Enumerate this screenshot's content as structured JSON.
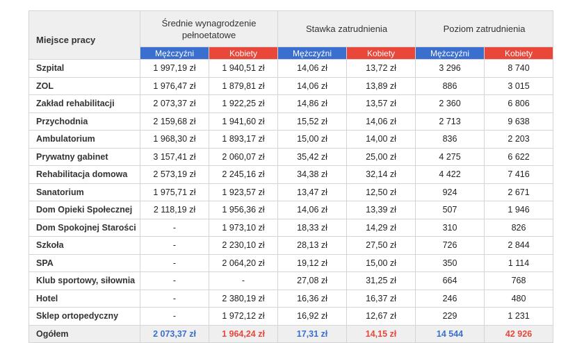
{
  "header": {
    "place_label": "Miejsce pracy",
    "group1": "Średnie wynagrodzenie pełnoetatowe",
    "group2": "Stawka zatrudnienia",
    "group3": "Poziom zatrudnienia",
    "male": "Mężczyźni",
    "female": "Kobiety"
  },
  "colors": {
    "male": "#3a6fcf",
    "female": "#e8473a",
    "header_bg": "#efefef"
  },
  "rows": [
    {
      "place": "Szpital",
      "wm": "1 997,19 zł",
      "wf": "1 940,51 zł",
      "rm": "14,06 zł",
      "rf": "13,72 zł",
      "em": "3 296",
      "ef": "8 740"
    },
    {
      "place": "ZOL",
      "wm": "1 976,47 zł",
      "wf": "1 879,81 zł",
      "rm": "14,06 zł",
      "rf": "13,89 zł",
      "em": "886",
      "ef": "3 015"
    },
    {
      "place": "Zakład rehabilitacji",
      "wm": "2 073,37 zł",
      "wf": "1 922,25 zł",
      "rm": "14,86 zł",
      "rf": "13,57 zł",
      "em": "2 360",
      "ef": "6 806"
    },
    {
      "place": "Przychodnia",
      "wm": "2 159,68 zł",
      "wf": "1 941,60 zł",
      "rm": "15,52 zł",
      "rf": "14,06 zł",
      "em": "2 713",
      "ef": "9 638"
    },
    {
      "place": "Ambulatorium",
      "wm": "1 968,30 zł",
      "wf": "1 893,17 zł",
      "rm": "15,00 zł",
      "rf": "14,00 zł",
      "em": "836",
      "ef": "2 203"
    },
    {
      "place": "Prywatny gabinet",
      "wm": "3 157,41 zł",
      "wf": "2 060,07 zł",
      "rm": "35,42 zł",
      "rf": "25,00 zł",
      "em": "4 275",
      "ef": "6 622"
    },
    {
      "place": "Rehabilitacja domowa",
      "wm": "2 573,19 zł",
      "wf": "2 245,16 zł",
      "rm": "34,38 zł",
      "rf": "32,14 zł",
      "em": "4 422",
      "ef": "7 416"
    },
    {
      "place": "Sanatorium",
      "wm": "1 975,71 zł",
      "wf": "1 923,57 zł",
      "rm": "13,47 zł",
      "rf": "12,50 zł",
      "em": "924",
      "ef": "2 671"
    },
    {
      "place": "Dom Opieki Społecznej",
      "wm": "2 118,19 zł",
      "wf": "1 956,36 zł",
      "rm": "14,06 zł",
      "rf": "13,39 zł",
      "em": "507",
      "ef": "1 946"
    },
    {
      "place": "Dom Spokojnej Starości",
      "wm": "-",
      "wf": "1 973,10 zł",
      "rm": "18,33 zł",
      "rf": "14,29 zł",
      "em": "310",
      "ef": "826"
    },
    {
      "place": "Szkoła",
      "wm": "-",
      "wf": "2 230,10 zł",
      "rm": "28,13 zł",
      "rf": "27,50 zł",
      "em": "726",
      "ef": "2 844"
    },
    {
      "place": "SPA",
      "wm": "-",
      "wf": "2 064,20 zł",
      "rm": "19,12 zł",
      "rf": "15,00 zł",
      "em": "350",
      "ef": "1 114"
    },
    {
      "place": "Klub sportowy, siłownia",
      "wm": "-",
      "wf": "-",
      "rm": "27,08 zł",
      "rf": "31,25 zł",
      "em": "664",
      "ef": "768"
    },
    {
      "place": "Hotel",
      "wm": "-",
      "wf": "2 380,19 zł",
      "rm": "16,36 zł",
      "rf": "16,37 zł",
      "em": "246",
      "ef": "480"
    },
    {
      "place": "Sklep ortopedyczny",
      "wm": "-",
      "wf": "1 972,12 zł",
      "rm": "16,92 zł",
      "rf": "12,67 zł",
      "em": "229",
      "ef": "1 231"
    }
  ],
  "total": {
    "place": "Ogółem",
    "wm": "2 073,37 zł",
    "wf": "1 964,24 zł",
    "rm": "17,31 zł",
    "rf": "14,15 zł",
    "em": "14 544",
    "ef": "42 926"
  }
}
